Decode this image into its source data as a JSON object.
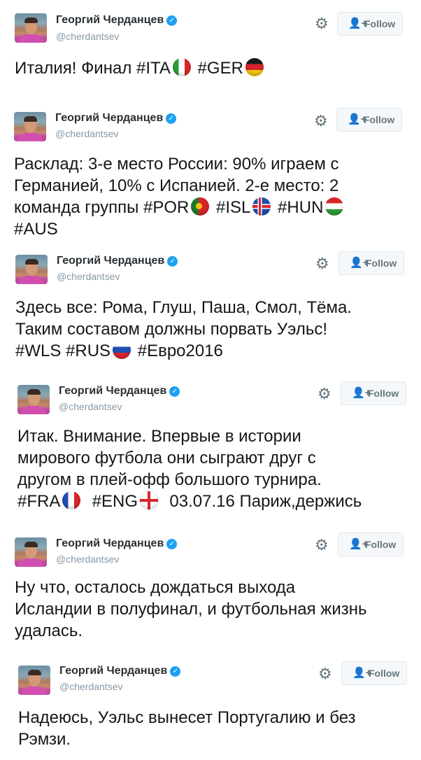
{
  "user": {
    "name": "Георгий Черданцев",
    "handle": "@cherdantsev",
    "verified_mark": "✓"
  },
  "follow_label": "Follow",
  "follow_icon": "follow-person-plus-icon",
  "gear_icon": "gear-icon",
  "colors": {
    "verified": "#1da1f2",
    "handle": "#8899a6",
    "button_bg": "#f5f8fa",
    "button_border": "#e1e8ed"
  },
  "tweets": [
    {
      "lines": [
        "Италия! Финал #ITA",
        " #GER"
      ],
      "flags": [
        "italy-flag",
        "germany-flag"
      ]
    },
    {
      "lines": [
        "Расклад: 3-е место России: 90% играем с",
        "Германией, 10% с Испанией. 2-е место: 2",
        "команда группы #POR",
        " #ISL",
        " #HUN",
        "#AUS"
      ],
      "flags": [
        "portugal-flag",
        "iceland-flag",
        "hungary-flag"
      ]
    },
    {
      "lines": [
        "Здесь все: Рома, Глуш, Паша, Смол, Тёма.",
        "Таким составом должны порвать Уэльс!",
        "#WLS #RUS",
        " #Евро2016"
      ],
      "flags": [
        "russia-flag"
      ]
    },
    {
      "lines": [
        "Итак. Внимание. Впервые в истории",
        "мирового футбола они сыграют друг с",
        "другом в плей-офф большого турнира.",
        "#FRA",
        "  #ENG",
        "  03.07.16 Париж,держись"
      ],
      "flags": [
        "france-flag",
        "england-flag"
      ]
    },
    {
      "lines": [
        "Ну что, осталось дождаться выхода",
        "Исландии в полуфинал, и футбольная жизнь",
        "удалась."
      ],
      "flags": []
    },
    {
      "lines": [
        "Надеюсь, Уэльс вынесет Португалию и без",
        "Рэмзи."
      ],
      "flags": []
    }
  ]
}
